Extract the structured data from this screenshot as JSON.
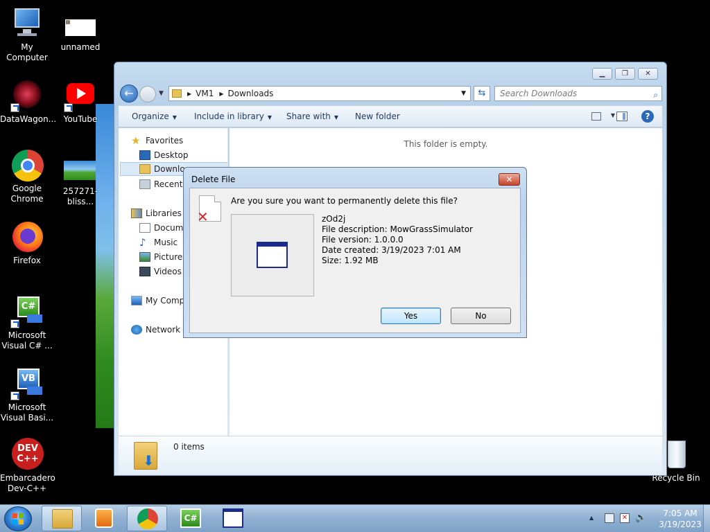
{
  "desktop": {
    "icons": [
      {
        "label": "My Computer"
      },
      {
        "label": "unnamed"
      },
      {
        "label": "DataWagon..."
      },
      {
        "label": "YouTube"
      },
      {
        "label": "Google Chrome"
      },
      {
        "label": "257271-bliss..."
      },
      {
        "label": "Firefox"
      },
      {
        "label": "Microsoft Visual C# ..."
      },
      {
        "label": "Microsoft Visual Basi..."
      },
      {
        "label": "Embarcadero Dev-C++"
      },
      {
        "label": "Recycle Bin"
      }
    ]
  },
  "explorer": {
    "breadcrumb": [
      "VM1",
      "Downloads"
    ],
    "search_placeholder": "Search Downloads",
    "toolbar": {
      "organize": "Organize",
      "include_in_library": "Include in library",
      "share_with": "Share with",
      "new_folder": "New folder"
    },
    "nav": {
      "favorites": "Favorites",
      "desktop": "Desktop",
      "downloads": "Downlo",
      "recent_places": "Recent P",
      "libraries": "Libraries",
      "documents": "Docume",
      "music": "Music",
      "pictures": "Pictures",
      "videos": "Videos",
      "my_computer": "My Comp",
      "network": "Network"
    },
    "empty_message": "This folder is empty.",
    "status": "0 items"
  },
  "dialog": {
    "title": "Delete File",
    "question": "Are you sure you want to permanently delete this file?",
    "file_name": "zOd2j",
    "file_description": "File description: MowGrassSimulator",
    "file_version": "File version: 1.0.0.0",
    "date_created": "Date created: 3/19/2023 7:01 AM",
    "size": "Size: 1.92 MB",
    "yes_label": "Yes",
    "no_label": "No"
  },
  "taskbar": {
    "time": "7:05 AM",
    "date": "3/19/2023"
  },
  "colors": {
    "taskbar": "#8fb0d2",
    "explorer_frame": "#c6dcf0",
    "dialog_frame": "#bcd3ec",
    "close_red": "#c8442c"
  }
}
